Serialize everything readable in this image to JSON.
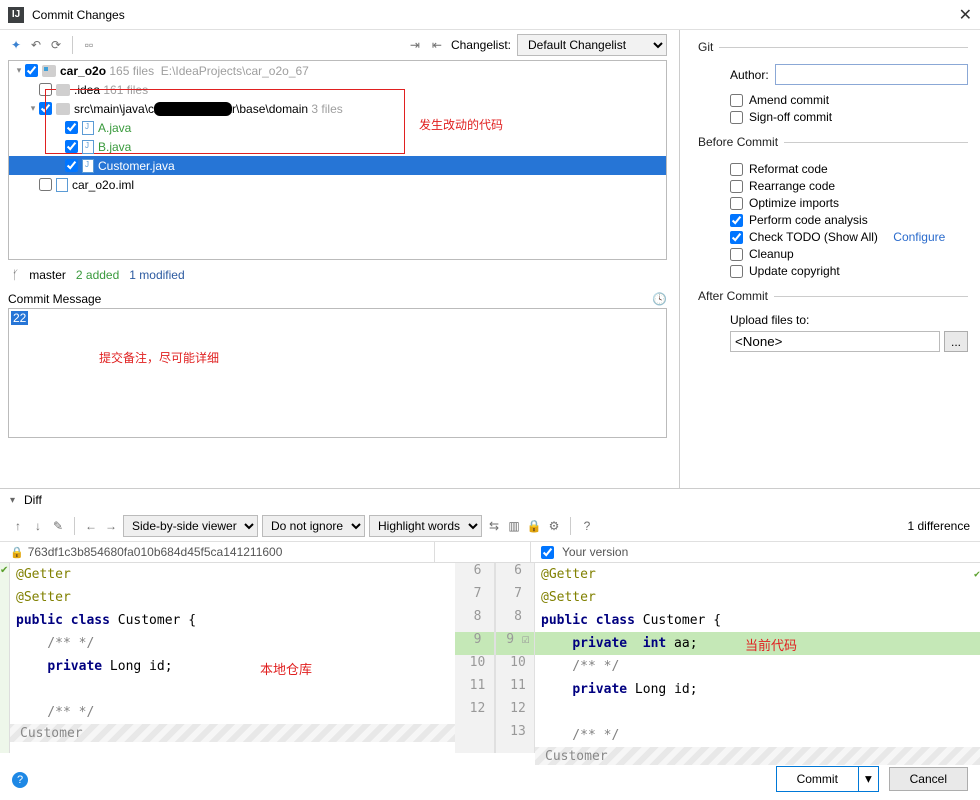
{
  "window": {
    "title": "Commit Changes"
  },
  "toolbar": {
    "changelist_label": "Changelist:",
    "changelist_value": "Default Changelist"
  },
  "tree": {
    "root": {
      "name": "car_o2o",
      "meta_files": "165 files",
      "path": "E:\\IdeaProjects\\car_o2o_67"
    },
    "idea": {
      "name": ".idea",
      "meta_files": "161 files"
    },
    "domain": {
      "path": "src\\main\\java\\c",
      "path_tail": "r\\base\\domain",
      "meta_files": "3 files"
    },
    "files": {
      "a": "A.java",
      "b": "B.java",
      "customer": "Customer.java"
    },
    "iml": "car_o2o.iml"
  },
  "annotations": {
    "changed_code": "发生改动的代码",
    "commit_note": "提交备注，尽可能详细",
    "local_repo": "本地仓库",
    "current_code": "当前代码"
  },
  "status": {
    "branch": "master",
    "added": "2 added",
    "modified": "1 modified"
  },
  "commit_message": {
    "header": "Commit Message",
    "text": "22"
  },
  "git": {
    "legend": "Git",
    "author_label": "Author:",
    "amend": "Amend commit",
    "signoff": "Sign-off commit"
  },
  "before": {
    "legend": "Before Commit",
    "reformat": "Reformat code",
    "rearrange": "Rearrange code",
    "optimize": "Optimize imports",
    "analysis": "Perform code analysis",
    "todo": "Check TODO (Show All)",
    "configure": "Configure",
    "cleanup": "Cleanup",
    "copyright": "Update copyright"
  },
  "after": {
    "legend": "After Commit",
    "upload_label": "Upload files to:",
    "upload_value": "<None>",
    "more": "..."
  },
  "diff": {
    "header": "Diff",
    "viewer": "Side-by-side viewer",
    "ignore": "Do not ignore",
    "highlight": "Highlight words",
    "count": "1 difference",
    "left_hash": "763df1c3b854680fa010b684d45f5ca141211600",
    "right_label": "Your version",
    "left_code": [
      "@Getter",
      "@Setter",
      "public class Customer {",
      "    /** */",
      "    private Long id;",
      "",
      "    /** */"
    ],
    "right_code": [
      "@Getter",
      "@Setter",
      "public class Customer {",
      "    private  int aa;",
      "    /** */",
      "    private Long id;",
      "",
      "    /** */"
    ],
    "gutter_left": [
      "6",
      "7",
      "8",
      "9",
      "10",
      "11",
      "12",
      ""
    ],
    "gutter_right": [
      "6",
      "7",
      "8",
      "9",
      "10",
      "11",
      "12",
      "13"
    ],
    "folded": "Customer"
  },
  "buttons": {
    "commit": "Commit",
    "cancel": "Cancel"
  }
}
